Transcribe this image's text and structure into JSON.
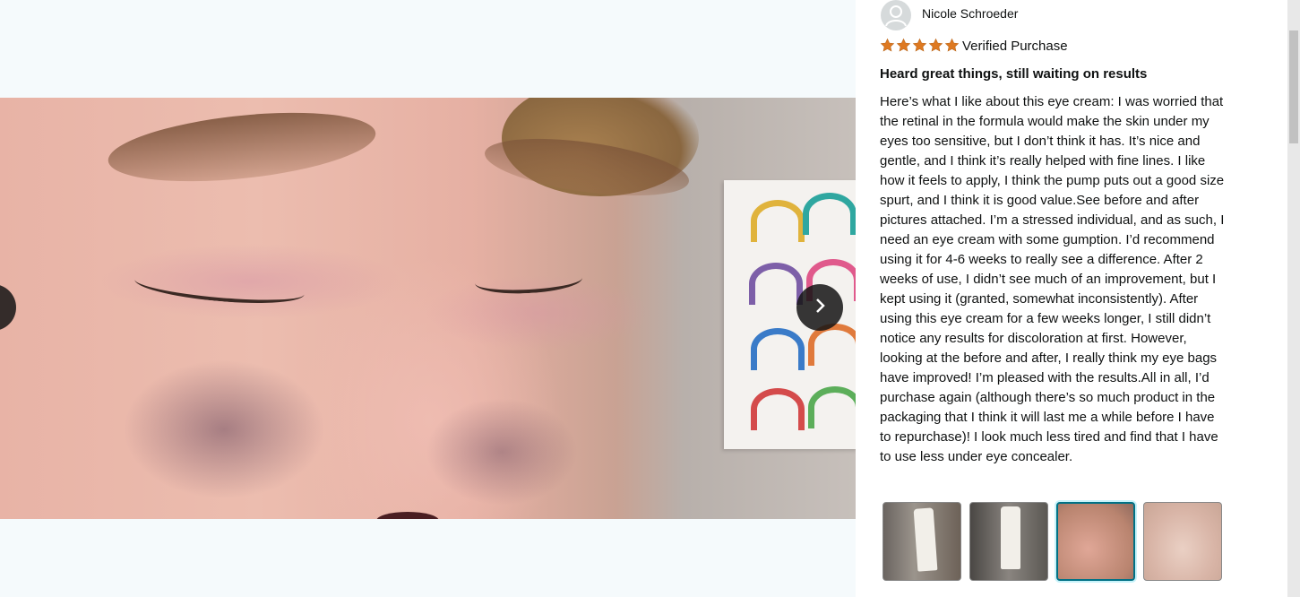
{
  "reviewer": {
    "name": "Nicole Schroeder",
    "rating": 5,
    "rating_max": 5,
    "verified_label": "Verified Purchase"
  },
  "review": {
    "title": "Heard great things, still waiting on results",
    "body": "Here’s what I like about this eye cream: I was worried that the retinal in the formula would make the skin under my eyes too sensitive, but I don’t think it has. It’s nice and gentle, and I think it’s really helped with fine lines. I like how it feels to apply, I think the pump puts out a good size spurt, and I think it is good value.See before and after pictures attached. I’m a stressed individual, and as such, I need an eye cream with some gumption. I’d recommend using it for 4-6 weeks to really see a difference. After 2 weeks of use, I didn’t see much of an improvement, but I kept using it (granted, somewhat inconsistently). After using this eye cream for a few weeks longer, I still didn’t notice any results for discoloration at first. However, looking at the before and after, I really think my eye bags have improved! I’m pleased with the results.All in all, I’d purchase again (although there’s so much product in the packaging that I think it will last me a while before I have to repurchase)! I look much less tired and find that I have to use less under eye concealer."
  },
  "gallery": {
    "selected_index": 2,
    "thumbnail_count": 4
  },
  "icons": {
    "next": "chevron-right-icon",
    "prev": "chevron-left-icon",
    "avatar": "user-icon",
    "star": "star-icon"
  },
  "colors": {
    "star": "#de7921",
    "selected_border": "#007185",
    "text": "#0f1111"
  }
}
